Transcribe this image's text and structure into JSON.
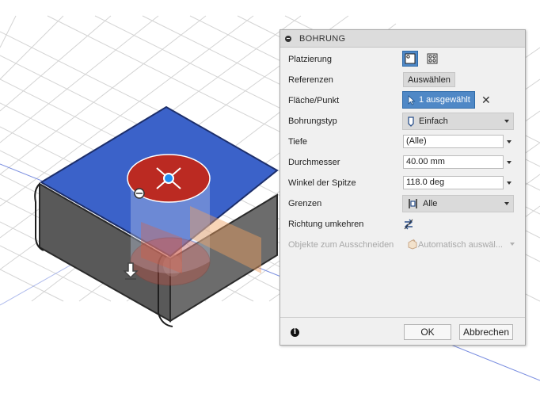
{
  "dialog": {
    "title": "BOHRUNG",
    "rows": {
      "placement": {
        "label": "Platzierung"
      },
      "references": {
        "label": "Referenzen",
        "button": "Auswählen"
      },
      "face_point": {
        "label": "Fläche/Punkt",
        "selection": "1 ausgewählt"
      },
      "hole_type": {
        "label": "Bohrungstyp",
        "value": "Einfach"
      },
      "depth": {
        "label": "Tiefe",
        "value": "(Alle)"
      },
      "diameter": {
        "label": "Durchmesser",
        "value": "40.00 mm"
      },
      "tip_angle": {
        "label": "Winkel der Spitze",
        "value": "118.0 deg"
      },
      "extents": {
        "label": "Grenzen",
        "value": "Alle"
      },
      "flip_direction": {
        "label": "Richtung umkehren"
      },
      "objects_to_cut": {
        "label": "Objekte zum Ausschneiden",
        "value": "Automatisch auswäl..."
      }
    },
    "footer": {
      "ok": "OK",
      "cancel": "Abbrechen"
    }
  },
  "icons": {
    "collapse": "collapse-circle-icon",
    "single_hole": "single-hole-placement-icon",
    "multi_hole": "multi-hole-placement-icon",
    "cursor": "cursor-arrow-icon",
    "clear": "close-x-icon",
    "hole_type": "simple-hole-icon",
    "extents": "extents-all-icon",
    "flip": "flip-direction-icon",
    "objects": "auto-select-objects-icon",
    "info": "info-icon",
    "move_manipulator": "move-arrow-icon"
  },
  "colors": {
    "top_face": "#3b62c9",
    "body": "#5e5e5e",
    "hole_preview": "#bb2a22",
    "accent": "#4f88c6"
  }
}
